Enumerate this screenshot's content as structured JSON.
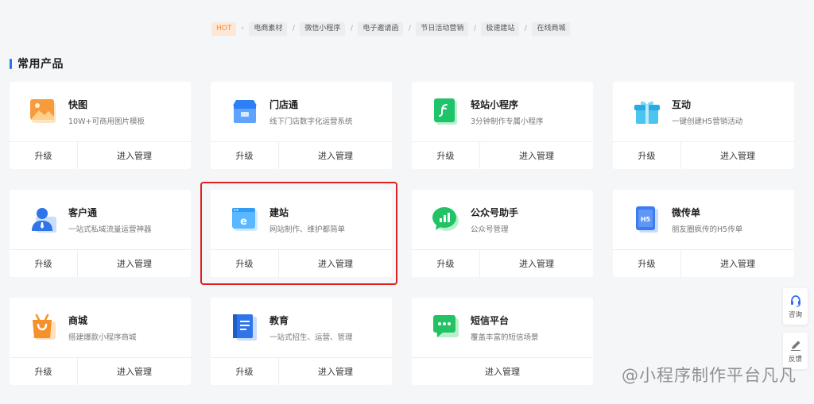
{
  "tags": [
    "HOT",
    "电商素材",
    "微信小程序",
    "电子邀请函",
    "节日活动营销",
    "极速建站",
    "在线商城"
  ],
  "section_title": "常用产品",
  "cards": [
    {
      "name": "快图",
      "desc": "10W+可商用图片模板",
      "upgrade": "升级",
      "manage": "进入管理",
      "icon": "image-icon"
    },
    {
      "name": "门店通",
      "desc": "线下门店数字化运营系统",
      "upgrade": "升级",
      "manage": "进入管理",
      "icon": "store-icon"
    },
    {
      "name": "轻站小程序",
      "desc": "3分钟制作专属小程序",
      "upgrade": "升级",
      "manage": "进入管理",
      "icon": "mini-program-icon"
    },
    {
      "name": "互动",
      "desc": "一键创建H5营销活动",
      "upgrade": "升级",
      "manage": "进入管理",
      "icon": "gift-icon"
    },
    {
      "name": "客户通",
      "desc": "一站式私域流量运营神器",
      "upgrade": "升级",
      "manage": "进入管理",
      "icon": "customer-icon"
    },
    {
      "name": "建站",
      "desc": "网站制作、维护都简单",
      "upgrade": "升级",
      "manage": "进入管理",
      "icon": "website-icon"
    },
    {
      "name": "公众号助手",
      "desc": "公众号管理",
      "upgrade": "升级",
      "manage": "进入管理",
      "icon": "wechat-chart-icon"
    },
    {
      "name": "微传单",
      "desc": "朋友圈疯传的H5传单",
      "upgrade": "升级",
      "manage": "进入管理",
      "icon": "h5-flyer-icon"
    },
    {
      "name": "商城",
      "desc": "搭建爆款小程序商城",
      "upgrade": "升级",
      "manage": "进入管理",
      "icon": "shopping-bag-icon"
    },
    {
      "name": "教育",
      "desc": "一站式招生、运营、管理",
      "upgrade": "升级",
      "manage": "进入管理",
      "icon": "book-icon"
    },
    {
      "name": "短信平台",
      "desc": "覆盖丰富的短信场景",
      "manage": "进入管理",
      "icon": "sms-icon"
    }
  ],
  "float": {
    "consult": "咨询",
    "feedback": "反馈"
  },
  "watermark": "@小程序制作平台凡凡",
  "colors": {
    "accent": "#2e6ff5",
    "highlight": "#e02020",
    "hot": "#f08a3c"
  }
}
